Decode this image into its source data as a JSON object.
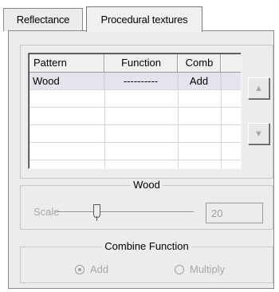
{
  "tabs": [
    "Reflectance",
    "Procedural textures"
  ],
  "list": {
    "headers": [
      "Pattern",
      "Function",
      "Comb"
    ],
    "rows": [
      {
        "pattern": "Wood",
        "function": "----------",
        "comb": "Add"
      }
    ]
  },
  "side_buttons": {
    "up_icon": "arrow-up-icon",
    "down_icon": "arrow-down-icon"
  },
  "wood_group": {
    "caption": "Wood",
    "scale_label": "Scale",
    "scale_value": "20",
    "slider_fraction": 0.3
  },
  "combine_group": {
    "caption": "Combine Function",
    "options": [
      "Add",
      "Multiply"
    ],
    "selected": "Add"
  }
}
